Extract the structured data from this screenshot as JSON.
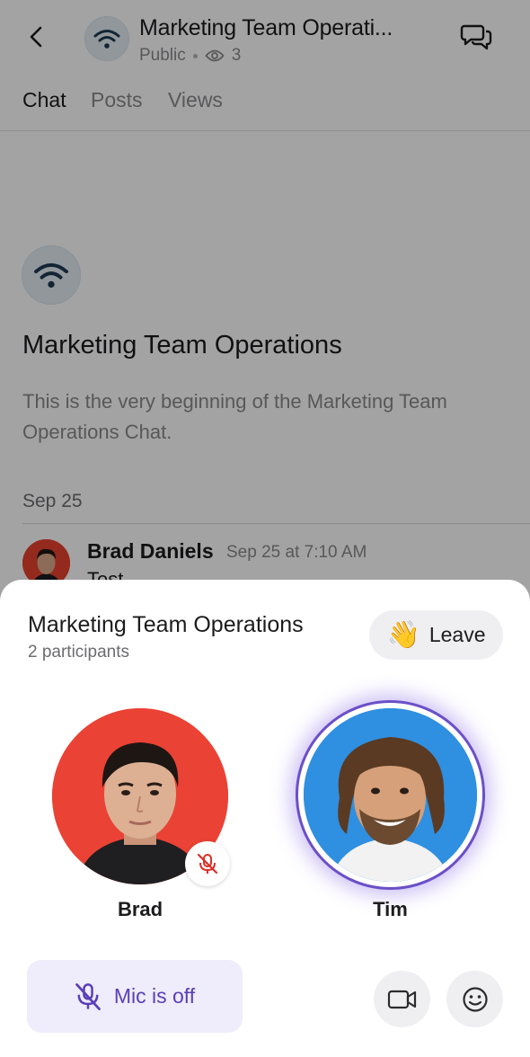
{
  "header": {
    "title": "Marketing Team Operati...",
    "visibility": "Public",
    "viewer_count": "3"
  },
  "tabs": [
    {
      "label": "Chat",
      "active": true
    },
    {
      "label": "Posts",
      "active": false
    },
    {
      "label": "Views",
      "active": false
    }
  ],
  "channel_intro": {
    "title": "Marketing Team Operations",
    "description": "This is the very beginning of the Marketing Team Operations Chat."
  },
  "messages": {
    "date_separator": "Sep 25",
    "items": [
      {
        "author": "Brad Daniels",
        "time": "Sep 25 at 7:10 AM",
        "text": "Test"
      }
    ]
  },
  "call_sheet": {
    "title": "Marketing Team Operations",
    "participant_count": "2 participants",
    "leave_label": "Leave",
    "leave_emoji": "👋",
    "participants": [
      {
        "name": "Brad",
        "muted": true,
        "speaking": false
      },
      {
        "name": "Tim",
        "muted": false,
        "speaking": true
      }
    ],
    "mic_label": "Mic is off"
  },
  "colors": {
    "accent": "#5a3fb8",
    "accent_bg": "#efecfb",
    "muted_red": "#d93025",
    "speaking_ring": "#6b4fc8",
    "brad_bg": "#ea4235",
    "tim_bg": "#2f8fe0",
    "channel_icon": "#1f3b52"
  },
  "icons": {
    "back": "chevron-left-icon",
    "channel": "wifi-broadcast-icon",
    "views": "eye-icon",
    "threads": "chat-bubbles-icon",
    "muted": "mic-off-icon",
    "camera": "video-camera-icon",
    "reactions": "smiley-icon"
  }
}
